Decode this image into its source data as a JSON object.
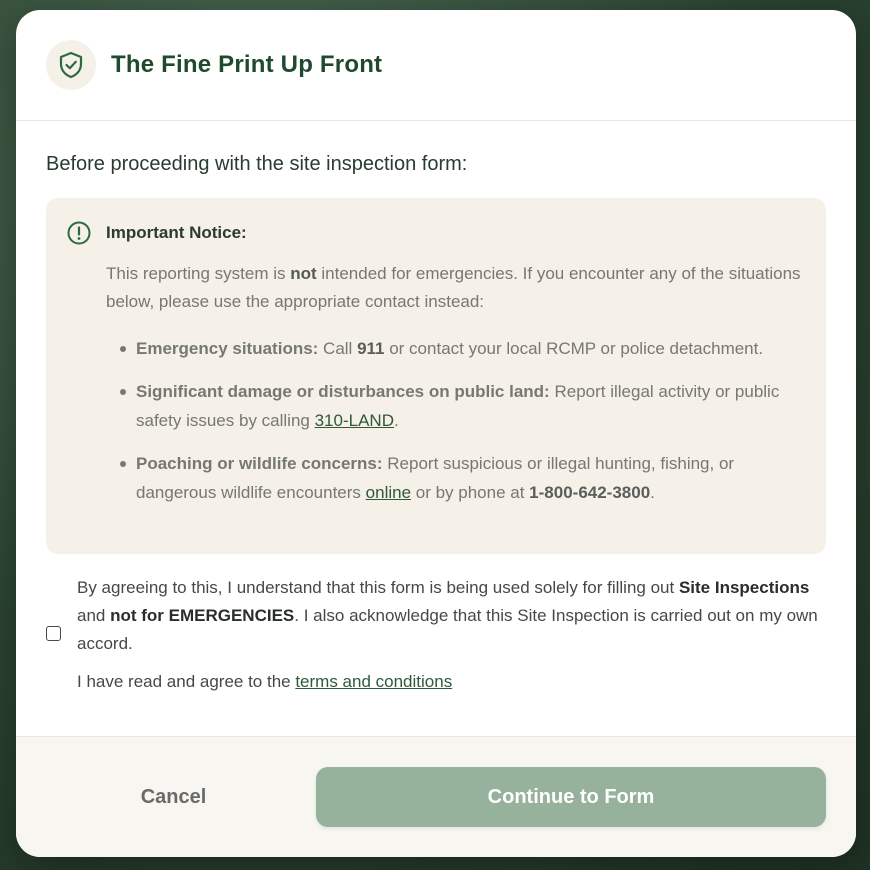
{
  "modal": {
    "title": "The Fine Print Up Front",
    "header_icon": "shield-check-icon",
    "intro": "Before proceeding with the site inspection form:"
  },
  "notice": {
    "icon": "alert-circle-icon",
    "title": "Important Notice:",
    "text_before": "This reporting system is ",
    "text_strong": "not",
    "text_after": " intended for emergencies. If you encounter any of the situations below, please use the appropriate contact instead:",
    "items": [
      {
        "label": "Emergency situations:",
        "text_a": " Call ",
        "strong": "911",
        "text_b": " or contact your local RCMP or police detachment."
      },
      {
        "label": "Significant damage or disturbances on public land:",
        "text_a": " Report illegal activity or public safety issues by calling ",
        "link": "310-LAND",
        "text_b": "."
      },
      {
        "label": "Poaching or wildlife concerns:",
        "text_a": " Report suspicious or illegal hunting, fishing, or dangerous wildlife encounters ",
        "link": "online",
        "text_b": " or by phone at ",
        "strong": "1-800-642-3800",
        "text_c": "."
      }
    ]
  },
  "agreement": {
    "p1": "By agreeing to this, I understand that this form is being used solely for filling out ",
    "b1": "Site Inspections",
    "p2": " and ",
    "b2": "not for EMERGENCIES",
    "p3": ". I also acknowledge that this Site Inspection is carried out on my own accord.",
    "terms_prefix": "I have read and agree to the ",
    "terms_link": "terms and conditions",
    "checked": false
  },
  "footer": {
    "cancel_label": "Cancel",
    "continue_label": "Continue to Form"
  },
  "colors": {
    "brand": "#1f4a2e",
    "continue_bg": "#97b29c",
    "notice_bg": "#f5f0e8"
  }
}
